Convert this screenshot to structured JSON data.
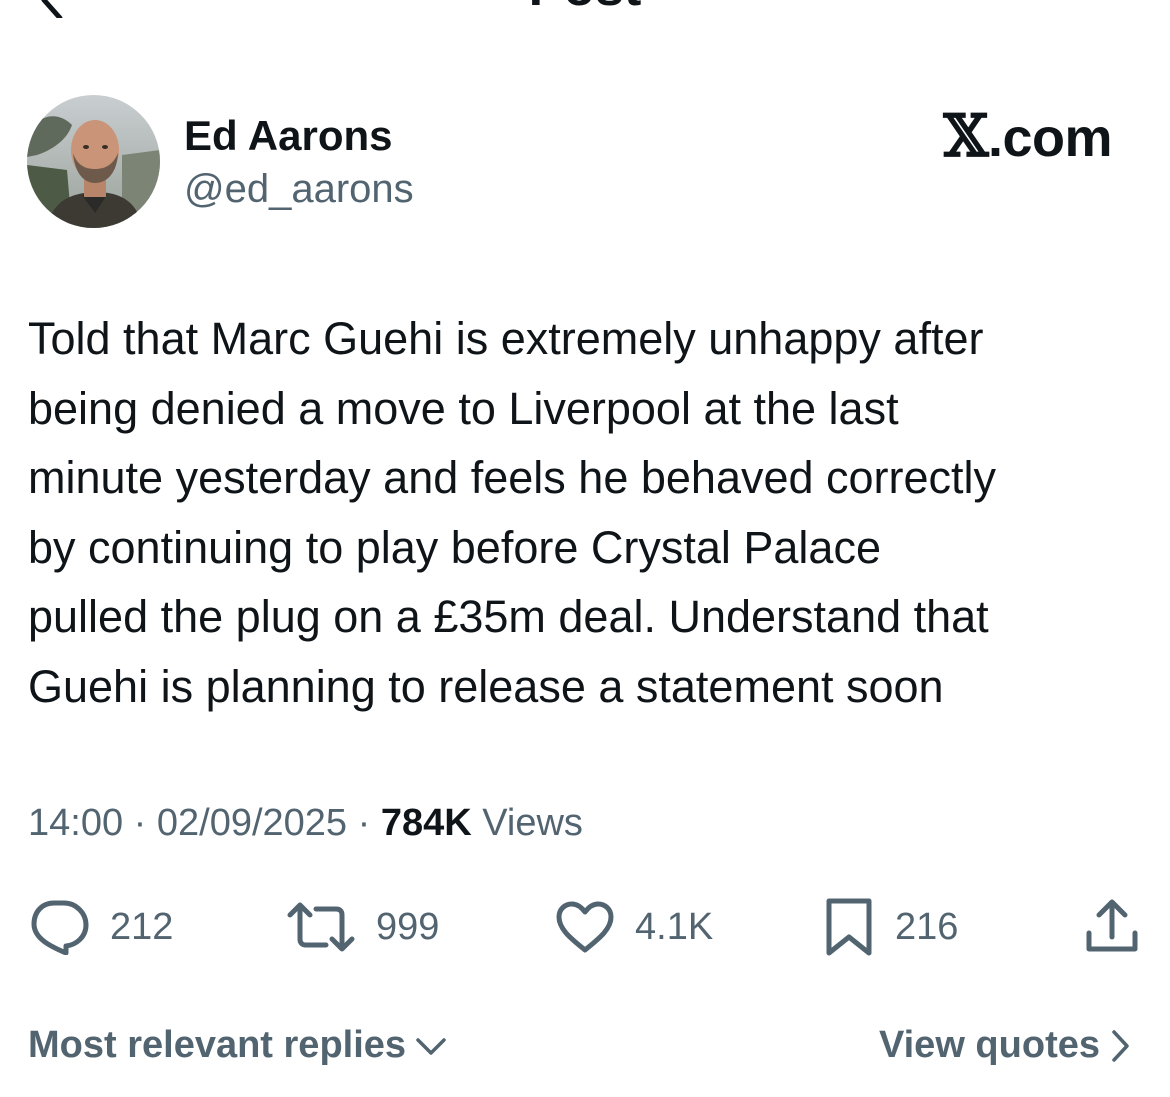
{
  "header": {
    "title": "Post",
    "back_icon": "chevron-left-icon"
  },
  "author": {
    "name": "Ed Aarons",
    "handle": "@ed_aarons",
    "avatar_icon": "avatar-photo"
  },
  "brand": {
    "mark": "𝕏",
    "suffix": ".com"
  },
  "post": {
    "lines": [
      "Told that Marc Guehi is extremely unhappy after",
      "being denied a move to Liverpool at the last",
      "minute yesterday and feels he behaved correctly",
      "by continuing to play before Crystal Palace",
      "pulled the plug on a £35m deal. Understand that",
      "Guehi is planning to release a statement soon"
    ]
  },
  "meta": {
    "time": "14:00",
    "separator": "·",
    "date": "02/09/2025",
    "views_count": "784K",
    "views_label": "Views"
  },
  "actions": {
    "replies": "212",
    "reposts": "999",
    "likes": "4.1K",
    "bookmarks": "216",
    "icons": [
      "reply-icon",
      "repost-icon",
      "like-icon",
      "bookmark-icon",
      "share-icon"
    ]
  },
  "replies_bar": {
    "sort_label": "Most relevant replies",
    "quotes_label": "View quotes"
  },
  "colors": {
    "text_primary": "#0f1419",
    "text_secondary": "#536471",
    "background": "#ffffff"
  }
}
